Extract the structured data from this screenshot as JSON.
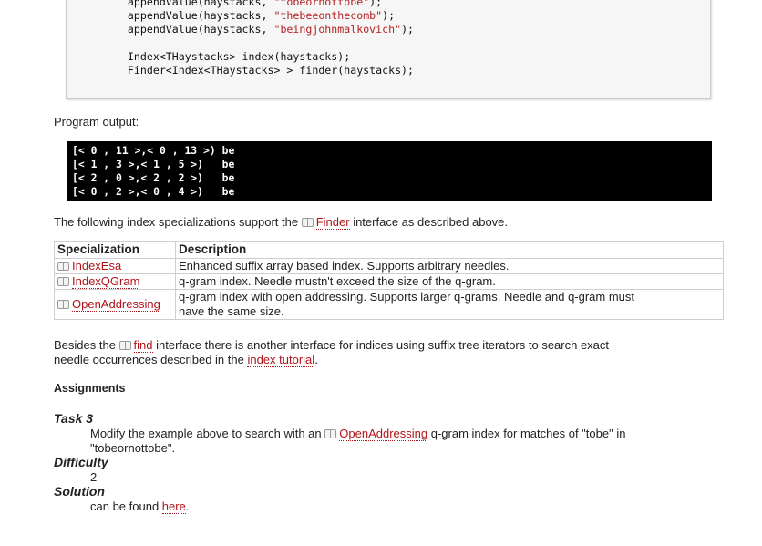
{
  "code": {
    "lines": [
      [
        "    appendValue(haystacks, ",
        "\"tobeornottobe\"",
        ");"
      ],
      [
        "    appendValue(haystacks, ",
        "\"thebeeonthecomb\"",
        ");"
      ],
      [
        "    appendValue(haystacks, ",
        "\"beingjohnmalkovich\"",
        ");"
      ]
    ],
    "index_line": "    Index<THaystacks> index(haystacks);",
    "finder_line": "    Finder<Index<THaystacks> > finder(haystacks);"
  },
  "output_label": "Program output:",
  "output_lines": [
    "[< 0 , 11 >,< 0 , 13 >) be",
    "[< 1 , 3 >,< 1 , 5 >)   be",
    "[< 2 , 0 >,< 2 , 2 >)   be",
    "[< 0 , 2 >,< 0 , 4 >)   be"
  ],
  "intro": {
    "before": "The following index specializations support the ",
    "link": "Finder",
    "after": " interface as described above."
  },
  "table": {
    "headers": [
      "Specialization",
      "Description"
    ],
    "rows": [
      {
        "name": "IndexEsa",
        "desc": "Enhanced suffix array based index. Supports arbitrary needles."
      },
      {
        "name": "IndexQGram",
        "desc": "q-gram index. Needle mustn't exceed the size of the q-gram."
      },
      {
        "name": "OpenAddressing",
        "desc1": "q-gram index with open addressing. Supports larger q-grams. Needle and q-gram must",
        "desc2": "have the same size."
      }
    ]
  },
  "besides": {
    "before": "Besides the ",
    "link": "find",
    "after": " interface there is another interface for indices using suffix tree iterators to search exact",
    "line2_before": "needle occurrences described in the ",
    "line2_link": "index tutorial",
    "line2_after": "."
  },
  "assignments_heading": "Assignments",
  "task": {
    "title": "Task 3",
    "text_before": "Modify the example above to search with an ",
    "text_link": "OpenAddressing",
    "text_after": " q-gram index for matches of \"tobe\" in",
    "text_line2": "\"tobeornottobe\".",
    "difficulty_label": "Difficulty",
    "difficulty_value": "2",
    "solution_label": "Solution",
    "solution_before": "can be found ",
    "solution_link": "here",
    "solution_after": "."
  },
  "colors": {
    "link": "#b0141a",
    "code_string": "#b22222",
    "output_bg": "#000000"
  }
}
